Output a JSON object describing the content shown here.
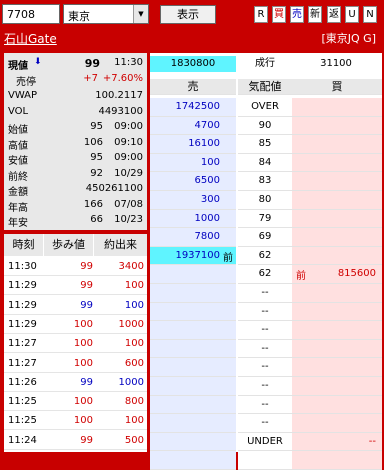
{
  "toolbar": {
    "code": "7708",
    "market": "東京",
    "show_label": "表示",
    "buttons": [
      "R",
      "買",
      "売",
      "新",
      "返",
      "U",
      "N"
    ]
  },
  "stock": {
    "name": "石山Gate",
    "market_label": "[東京JQ G]"
  },
  "info": {
    "price_label": "現値",
    "price": "99",
    "price_time": "11:30",
    "change_label": "売停",
    "change": "+7",
    "change_pct": "+7.60%",
    "rows": [
      {
        "label": "VWAP",
        "value": "100.2117",
        "time": ""
      },
      {
        "label": "VOL",
        "value": "4493100",
        "time": ""
      },
      {
        "label": "始値",
        "value": "95",
        "time": "09:00"
      },
      {
        "label": "高値",
        "value": "106",
        "time": "09:10"
      },
      {
        "label": "安値",
        "value": "95",
        "time": "09:00"
      },
      {
        "label": "前終",
        "value": "92",
        "time": "10/29"
      },
      {
        "label": "金額",
        "value": "450261100",
        "time": ""
      },
      {
        "label": "年高",
        "value": "166",
        "time": "07/08"
      },
      {
        "label": "年安",
        "value": "66",
        "time": "10/23"
      }
    ]
  },
  "board": {
    "top_sell": "1830800",
    "order_label": "成行",
    "top_buy": "31100",
    "headers": [
      "売",
      "気配値",
      "買"
    ],
    "rows": [
      {
        "sell": "1742500",
        "price": "OVER",
        "buy": "",
        "mark": ""
      },
      {
        "sell": "4700",
        "price": "90",
        "buy": "",
        "mark": ""
      },
      {
        "sell": "16100",
        "price": "85",
        "buy": "",
        "mark": ""
      },
      {
        "sell": "100",
        "price": "84",
        "buy": "",
        "mark": ""
      },
      {
        "sell": "6500",
        "price": "83",
        "buy": "",
        "mark": ""
      },
      {
        "sell": "300",
        "price": "80",
        "buy": "",
        "mark": ""
      },
      {
        "sell": "1000",
        "price": "79",
        "buy": "",
        "mark": ""
      },
      {
        "sell": "7800",
        "price": "69",
        "buy": "",
        "mark": ""
      },
      {
        "sell": "1937100",
        "price": "62",
        "buy": "",
        "mark": "前"
      },
      {
        "sell": "",
        "price": "62",
        "buy": "815600",
        "mark": "前"
      },
      {
        "sell": "",
        "price": "--",
        "buy": "",
        "mark": ""
      },
      {
        "sell": "",
        "price": "--",
        "buy": "",
        "mark": ""
      },
      {
        "sell": "",
        "price": "--",
        "buy": "",
        "mark": ""
      },
      {
        "sell": "",
        "price": "--",
        "buy": "",
        "mark": ""
      },
      {
        "sell": "",
        "price": "--",
        "buy": "",
        "mark": ""
      },
      {
        "sell": "",
        "price": "--",
        "buy": "",
        "mark": ""
      },
      {
        "sell": "",
        "price": "--",
        "buy": "",
        "mark": ""
      },
      {
        "sell": "",
        "price": "--",
        "buy": "",
        "mark": ""
      },
      {
        "sell": "",
        "price": "UNDER",
        "buy": "--",
        "mark": ""
      },
      {
        "sell": "",
        "price": "",
        "buy": "",
        "mark": ""
      }
    ]
  },
  "trades": {
    "headers": [
      "時刻",
      "歩み値",
      "約出来"
    ],
    "rows": [
      {
        "time": "11:30",
        "price": "99",
        "vol": "3400",
        "color": "#d00000"
      },
      {
        "time": "11:29",
        "price": "99",
        "vol": "100",
        "color": "#d00000"
      },
      {
        "time": "11:29",
        "price": "99",
        "vol": "100",
        "color": "#0000c0"
      },
      {
        "time": "11:29",
        "price": "100",
        "vol": "1000",
        "color": "#d00000"
      },
      {
        "time": "11:27",
        "price": "100",
        "vol": "100",
        "color": "#d00000"
      },
      {
        "time": "11:27",
        "price": "100",
        "vol": "600",
        "color": "#d00000"
      },
      {
        "time": "11:26",
        "price": "99",
        "vol": "1000",
        "color": "#0000c0"
      },
      {
        "time": "11:25",
        "price": "100",
        "vol": "800",
        "color": "#d00000"
      },
      {
        "time": "11:25",
        "price": "100",
        "vol": "100",
        "color": "#d00000"
      },
      {
        "time": "11:24",
        "price": "99",
        "vol": "500",
        "color": "#d00000"
      }
    ]
  }
}
